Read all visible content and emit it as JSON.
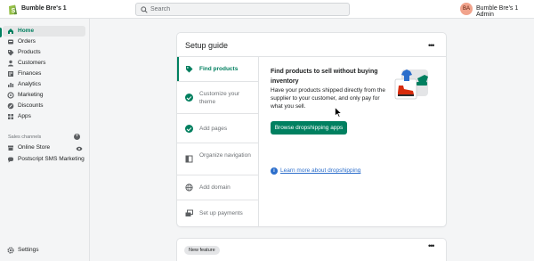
{
  "topbar": {
    "store_name": "Bumble Bre's 1",
    "search_placeholder": "Search",
    "avatar_initials": "BA",
    "admin_name": "Bumble Bre's 1 Admin"
  },
  "sidebar": {
    "items": [
      {
        "label": "Home",
        "icon": "home-icon",
        "active": true
      },
      {
        "label": "Orders",
        "icon": "orders-icon"
      },
      {
        "label": "Products",
        "icon": "tag-icon"
      },
      {
        "label": "Customers",
        "icon": "person-icon"
      },
      {
        "label": "Finances",
        "icon": "finances-icon"
      },
      {
        "label": "Analytics",
        "icon": "bar-chart-icon"
      },
      {
        "label": "Marketing",
        "icon": "target-icon"
      },
      {
        "label": "Discounts",
        "icon": "discount-icon"
      },
      {
        "label": "Apps",
        "icon": "apps-icon"
      }
    ],
    "sales_channels_title": "Sales channels",
    "channels": [
      {
        "label": "Online Store",
        "icon": "store-icon"
      },
      {
        "label": "Postscript SMS Marketing",
        "icon": "chat-icon"
      }
    ],
    "settings_label": "Settings"
  },
  "setup_guide": {
    "title": "Setup guide",
    "steps": [
      {
        "label": "Find products",
        "state": "active",
        "icon": "tag-icon"
      },
      {
        "label": "Customize your theme",
        "state": "done",
        "icon": "check-icon"
      },
      {
        "label": "Add pages",
        "state": "done",
        "icon": "check-icon"
      },
      {
        "label": "Organize navigation",
        "state": "todo",
        "icon": "navigation-icon"
      },
      {
        "label": "Add domain",
        "state": "todo",
        "icon": "globe-icon"
      },
      {
        "label": "Set up payments",
        "state": "todo",
        "icon": "payment-icon"
      }
    ],
    "content_title": "Find products to sell without buying inventory",
    "content_desc": "Have your products shipped directly from the supplier to your customer, and only pay for what you sell.",
    "primary_button": "Browse dropshipping apps",
    "learn_more": "Learn more about dropshipping"
  },
  "new_feature": {
    "badge": "New feature"
  },
  "colors": {
    "accent": "#008060",
    "link": "#2c6ecb"
  }
}
